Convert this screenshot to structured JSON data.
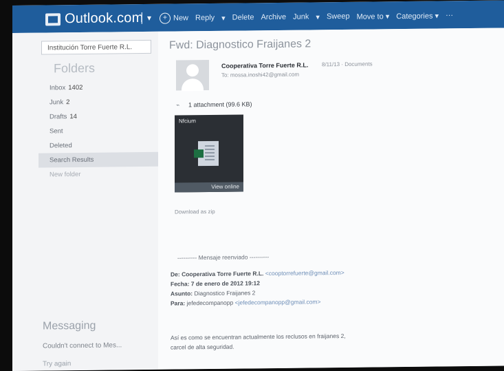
{
  "header": {
    "app_title": "Outlook.com",
    "separator": "|",
    "caret": "▾",
    "new_label": "New",
    "toolbar": [
      "Reply",
      "▾",
      "Delete",
      "Archive",
      "Junk",
      "▾",
      "Sweep",
      "Move to ▾",
      "Categories ▾",
      "···"
    ]
  },
  "sidebar": {
    "search_text": "Institución Torre Fuerte R.L.",
    "folders_title": "Folders",
    "folders": [
      {
        "label": "Inbox",
        "count": "1402"
      },
      {
        "label": "Junk",
        "count": "2"
      },
      {
        "label": "Drafts",
        "count": "14"
      },
      {
        "label": "Sent",
        "count": ""
      },
      {
        "label": "Deleted",
        "count": ""
      },
      {
        "label": "Search Results",
        "count": ""
      },
      {
        "label": "New folder",
        "count": ""
      }
    ],
    "messaging_title": "Messaging",
    "messaging_status": "Couldn't connect to Mes...",
    "try_again": "Try again"
  },
  "message": {
    "subject": "Fwd: Diagnostico Fraijanes 2",
    "sender": "Cooperativa Torre Fuerte R.L.",
    "meta": "8/11/13 · Documents",
    "to": "To: mossa.inoshi42@gmail.com",
    "attachment_count": "1 attachment (99.6 KB)",
    "attachment_name": "Nfcium",
    "view_online": "View online",
    "download_zip": "Download as zip",
    "forward_header": "---------- Mensaje reenviado ----------",
    "forward_lines": [
      {
        "label": "De:",
        "value": "Cooperativa Torre Fuerte R.L.",
        "link": "<cooptorrefuerte@gmail.com>"
      },
      {
        "label": "Fecha:",
        "value": "7 de enero de 2012 19:12",
        "link": ""
      },
      {
        "label": "Asunto:",
        "value": "Diagnostico Fraijanes 2",
        "link": ""
      },
      {
        "label": "Para:",
        "value": "jefedecompanopp",
        "link": "<jefedecompanopp@gmail.com>"
      }
    ],
    "body": "Así es como se encuentran actualmente los reclusos en fraijanes 2,",
    "body2": "carcel de alta seguridad."
  }
}
